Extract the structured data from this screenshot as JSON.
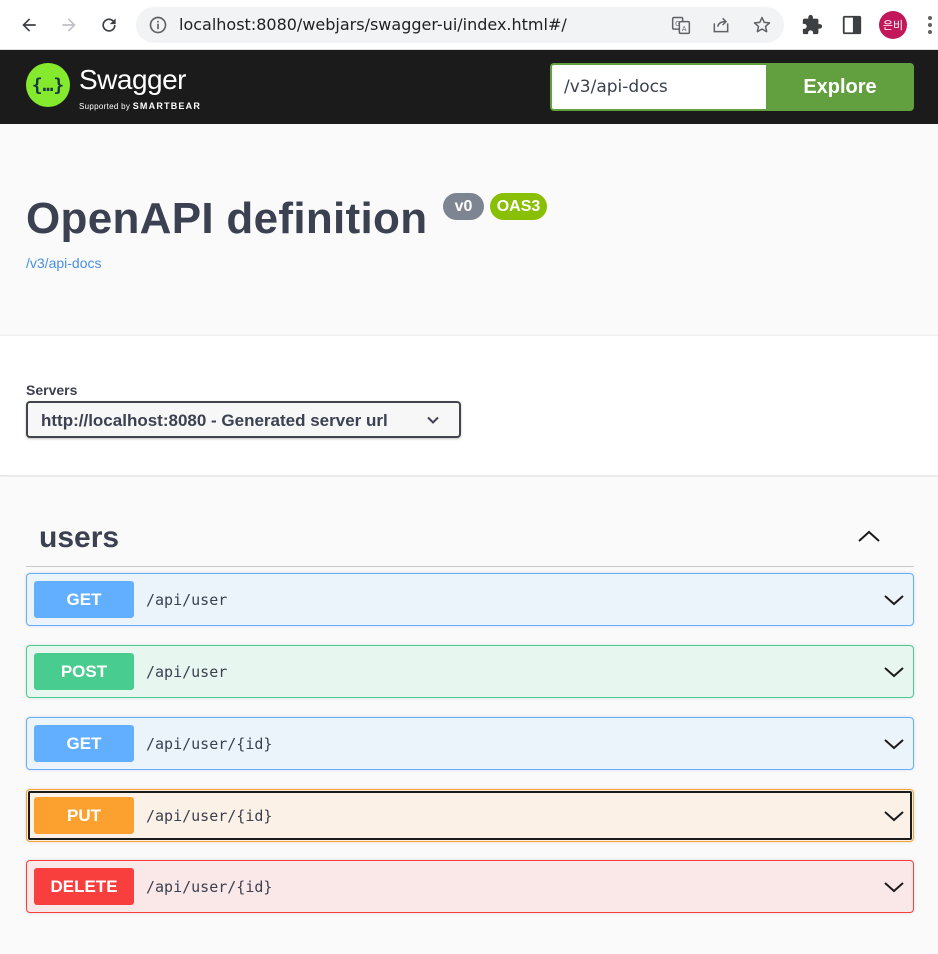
{
  "browser": {
    "url": "localhost:8080/webjars/swagger-ui/index.html#/",
    "profile_initials": "은비"
  },
  "topbar": {
    "brand_name": "Swagger",
    "brand_sub_prefix": "Supported by",
    "brand_sub_company": "SMARTBEAR",
    "spec_url_value": "/v3/api-docs",
    "explore_label": "Explore"
  },
  "info": {
    "title": "OpenAPI definition",
    "version_badge": "v0",
    "oas_badge": "OAS3",
    "spec_link": "/v3/api-docs"
  },
  "servers": {
    "label": "Servers",
    "selected": "http://localhost:8080 - Generated server url"
  },
  "tag": {
    "name": "users",
    "expanded": true
  },
  "operations": [
    {
      "method": "GET",
      "path": "/api/user"
    },
    {
      "method": "POST",
      "path": "/api/user"
    },
    {
      "method": "GET",
      "path": "/api/user/{id}"
    },
    {
      "method": "PUT",
      "path": "/api/user/{id}"
    },
    {
      "method": "DELETE",
      "path": "/api/user/{id}"
    }
  ],
  "colors": {
    "get": "#61affe",
    "post": "#49cc90",
    "put": "#fca130",
    "delete": "#f93e3e",
    "explore": "#62a03f",
    "logo": "#85ea2d"
  },
  "icons": [
    "back-icon",
    "forward-icon",
    "reload-icon",
    "info-icon",
    "translate-icon",
    "share-icon",
    "star-icon",
    "extensions-icon",
    "sidepanel-icon",
    "more-icon",
    "chevron-down-icon",
    "chevron-up-icon"
  ]
}
